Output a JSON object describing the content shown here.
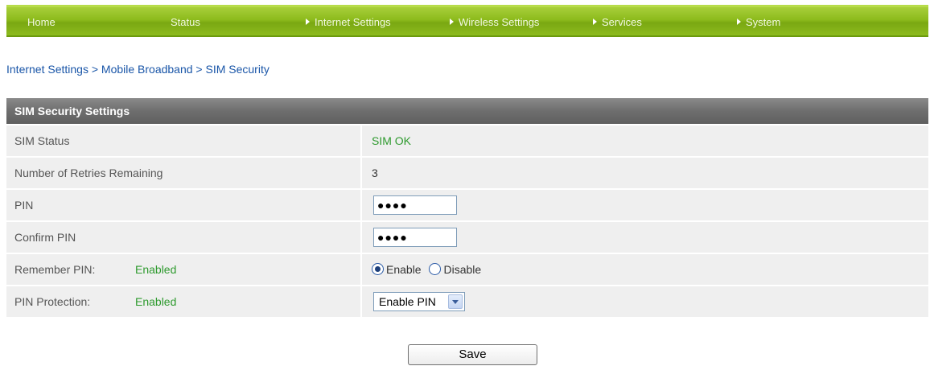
{
  "nav": {
    "items": [
      {
        "label": "Home",
        "arrow": false
      },
      {
        "label": "Status",
        "arrow": false
      },
      {
        "label": "Internet Settings",
        "arrow": true
      },
      {
        "label": "Wireless Settings",
        "arrow": true
      },
      {
        "label": "Services",
        "arrow": true
      },
      {
        "label": "System",
        "arrow": true
      }
    ]
  },
  "breadcrumb": "Internet Settings > Mobile Broadband > SIM Security",
  "panel": {
    "title": "SIM Security Settings",
    "sim_status": {
      "label": "SIM Status",
      "value": "SIM OK"
    },
    "retries": {
      "label": "Number of Retries Remaining",
      "value": "3"
    },
    "pin": {
      "label": "PIN",
      "value": "●●●●"
    },
    "confirm_pin": {
      "label": "Confirm PIN",
      "value": "●●●●"
    },
    "remember_pin": {
      "label": "Remember PIN:",
      "status": "Enabled",
      "options": [
        "Enable",
        "Disable"
      ],
      "selected": "Enable"
    },
    "pin_protection": {
      "label": "PIN Protection:",
      "status": "Enabled",
      "selected": "Enable PIN"
    }
  },
  "save_label": "Save",
  "colors": {
    "nav_green": "#8cba1c",
    "header_gray": "#6e6e6e",
    "status_green": "#2e9a2e",
    "link_blue": "#1a56a8"
  }
}
